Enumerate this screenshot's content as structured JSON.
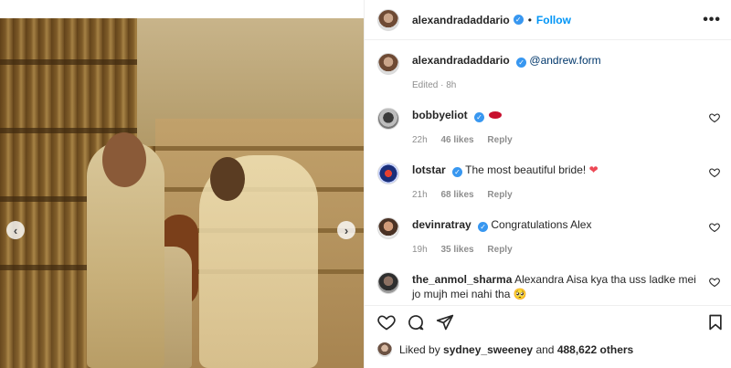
{
  "post": {
    "author": "alexandradaddario",
    "follow_label": "Follow",
    "separator": "•",
    "more_label": "•••",
    "verified_mark": "✓"
  },
  "photo": {
    "prev_label": "‹",
    "next_label": "›"
  },
  "caption": {
    "username": "alexandradaddario",
    "mention": "@andrew.form",
    "meta": "Edited · 8h"
  },
  "comments": [
    {
      "username": "bobbyeliot",
      "text": "",
      "verified": true,
      "time": "22h",
      "likes": "46 likes",
      "reply": "Reply"
    },
    {
      "username": "lotstar",
      "text": "The most beautiful bride!",
      "verified": true,
      "time": "21h",
      "likes": "68 likes",
      "reply": "Reply"
    },
    {
      "username": "devinratray",
      "text": "Congratulations Alex",
      "verified": true,
      "time": "19h",
      "likes": "35 likes",
      "reply": "Reply"
    },
    {
      "username": "the_anmol_sharma",
      "text": "Alexandra Aisa kya tha uss ladke mei jo mujh mei nahi tha 🥺",
      "verified": false
    }
  ],
  "likes": {
    "prefix": "Liked by",
    "user": "sydney_sweeney",
    "middle": "and",
    "count": "488,622 others"
  },
  "colors": {
    "link_blue": "#0095f6",
    "verified_blue": "#3897f0",
    "heart_red": "#ed4956",
    "meta_gray": "#8e8e8e"
  }
}
